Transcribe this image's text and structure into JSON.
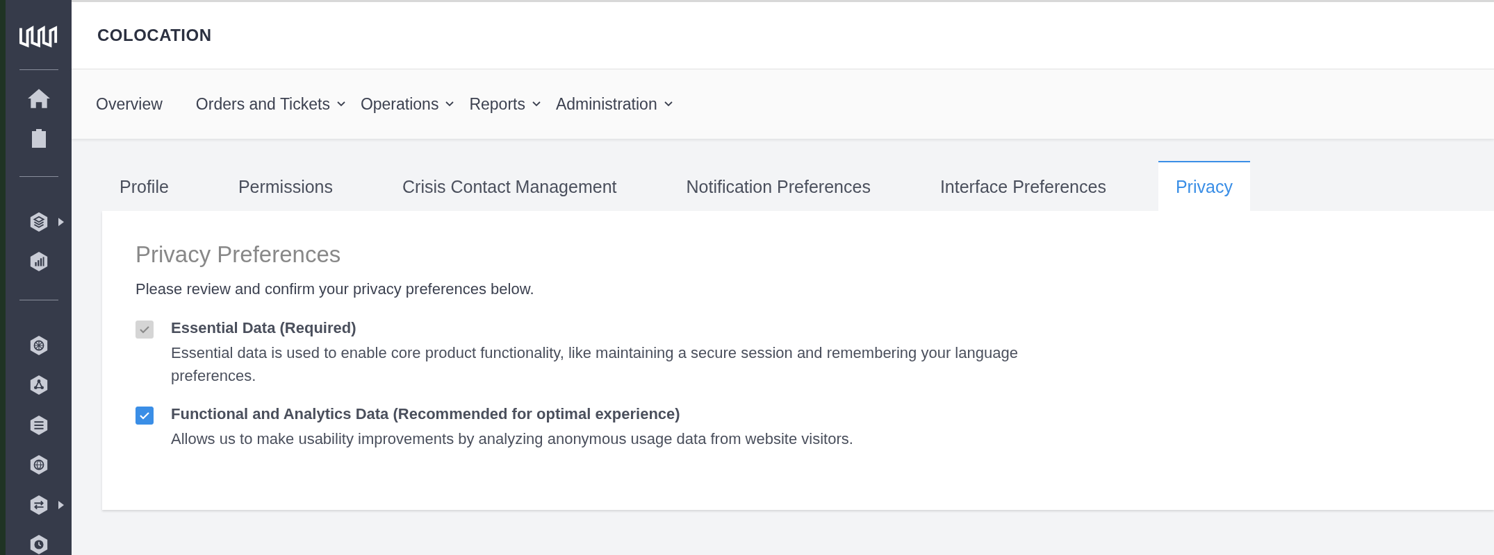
{
  "header": {
    "title": "COLOCATION"
  },
  "nav": [
    {
      "label": "Overview",
      "dropdown": false
    },
    {
      "label": "Orders and Tickets",
      "dropdown": true
    },
    {
      "label": "Operations",
      "dropdown": true
    },
    {
      "label": "Reports",
      "dropdown": true
    },
    {
      "label": "Administration",
      "dropdown": true
    }
  ],
  "tabs": [
    {
      "label": "Profile",
      "selected": false
    },
    {
      "label": "Permissions",
      "selected": false
    },
    {
      "label": "Crisis Contact Management",
      "selected": false
    },
    {
      "label": "Notification Preferences",
      "selected": false
    },
    {
      "label": "Interface Preferences",
      "selected": false
    },
    {
      "label": "Privacy",
      "selected": true
    }
  ],
  "privacy": {
    "heading": "Privacy Preferences",
    "intro": "Please review and confirm your privacy preferences below.",
    "options": [
      {
        "title": "Essential Data (Required)",
        "description": "Essential data is used to enable core product functionality, like maintaining a secure session and remembering your language preferences.",
        "checked": true,
        "disabled": true
      },
      {
        "title": "Functional and Analytics Data (Recommended for optimal experience)",
        "description": "Allows us to make usability improvements by analyzing anonymous usage data from website visitors.",
        "checked": true,
        "disabled": false
      }
    ]
  }
}
